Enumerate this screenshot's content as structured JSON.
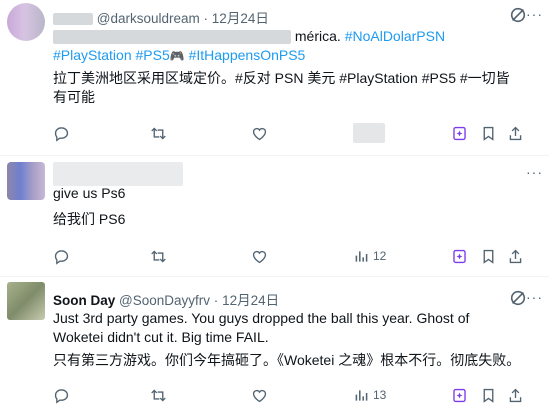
{
  "tweets": [
    {
      "handle": "@darksouldream",
      "dot": "·",
      "date": "12月24日",
      "line1_visible": "mérica.",
      "line1_tags": [
        "#NoAlDolarPSN"
      ],
      "line2_tags": [
        "#PlayStation",
        "#PS5",
        "🎮",
        "#ItHappensOnPS5"
      ],
      "translation": "拉丁美洲地区采用区域定价。#反对 PSN 美元 #PlayStation #PS5 #一切皆有可能",
      "actions": [
        "reply-icon",
        "retweet-icon",
        "like-icon",
        "views-icon",
        "grok-icon",
        "bookmark-icon",
        "share-icon"
      ]
    },
    {
      "text": "give us Ps6",
      "translation": "给我们 PS6",
      "views": "12",
      "actions": [
        "reply-icon",
        "retweet-icon",
        "like-icon",
        "views-icon",
        "grok-icon",
        "bookmark-icon",
        "share-icon"
      ]
    },
    {
      "name": "Soon Day",
      "handle": "@SoonDayyfrv",
      "dot": "·",
      "date": "12月24日",
      "text": "Just 3rd party games. You guys dropped the ball this year. Ghost of Woketei didn't cut it. Big time FAIL.",
      "translation": "只有第三方游戏。你们今年搞砸了。《Woketei 之魂》根本不行。彻底失败。",
      "views": "13",
      "actions": [
        "reply-icon",
        "retweet-icon",
        "like-icon",
        "views-icon",
        "grok-icon",
        "bookmark-icon",
        "share-icon"
      ]
    }
  ],
  "more_label": "···",
  "colors": {
    "link": "#1d9bf0",
    "muted": "#536471",
    "text": "#0f1419",
    "divider": "#eff3f4"
  }
}
